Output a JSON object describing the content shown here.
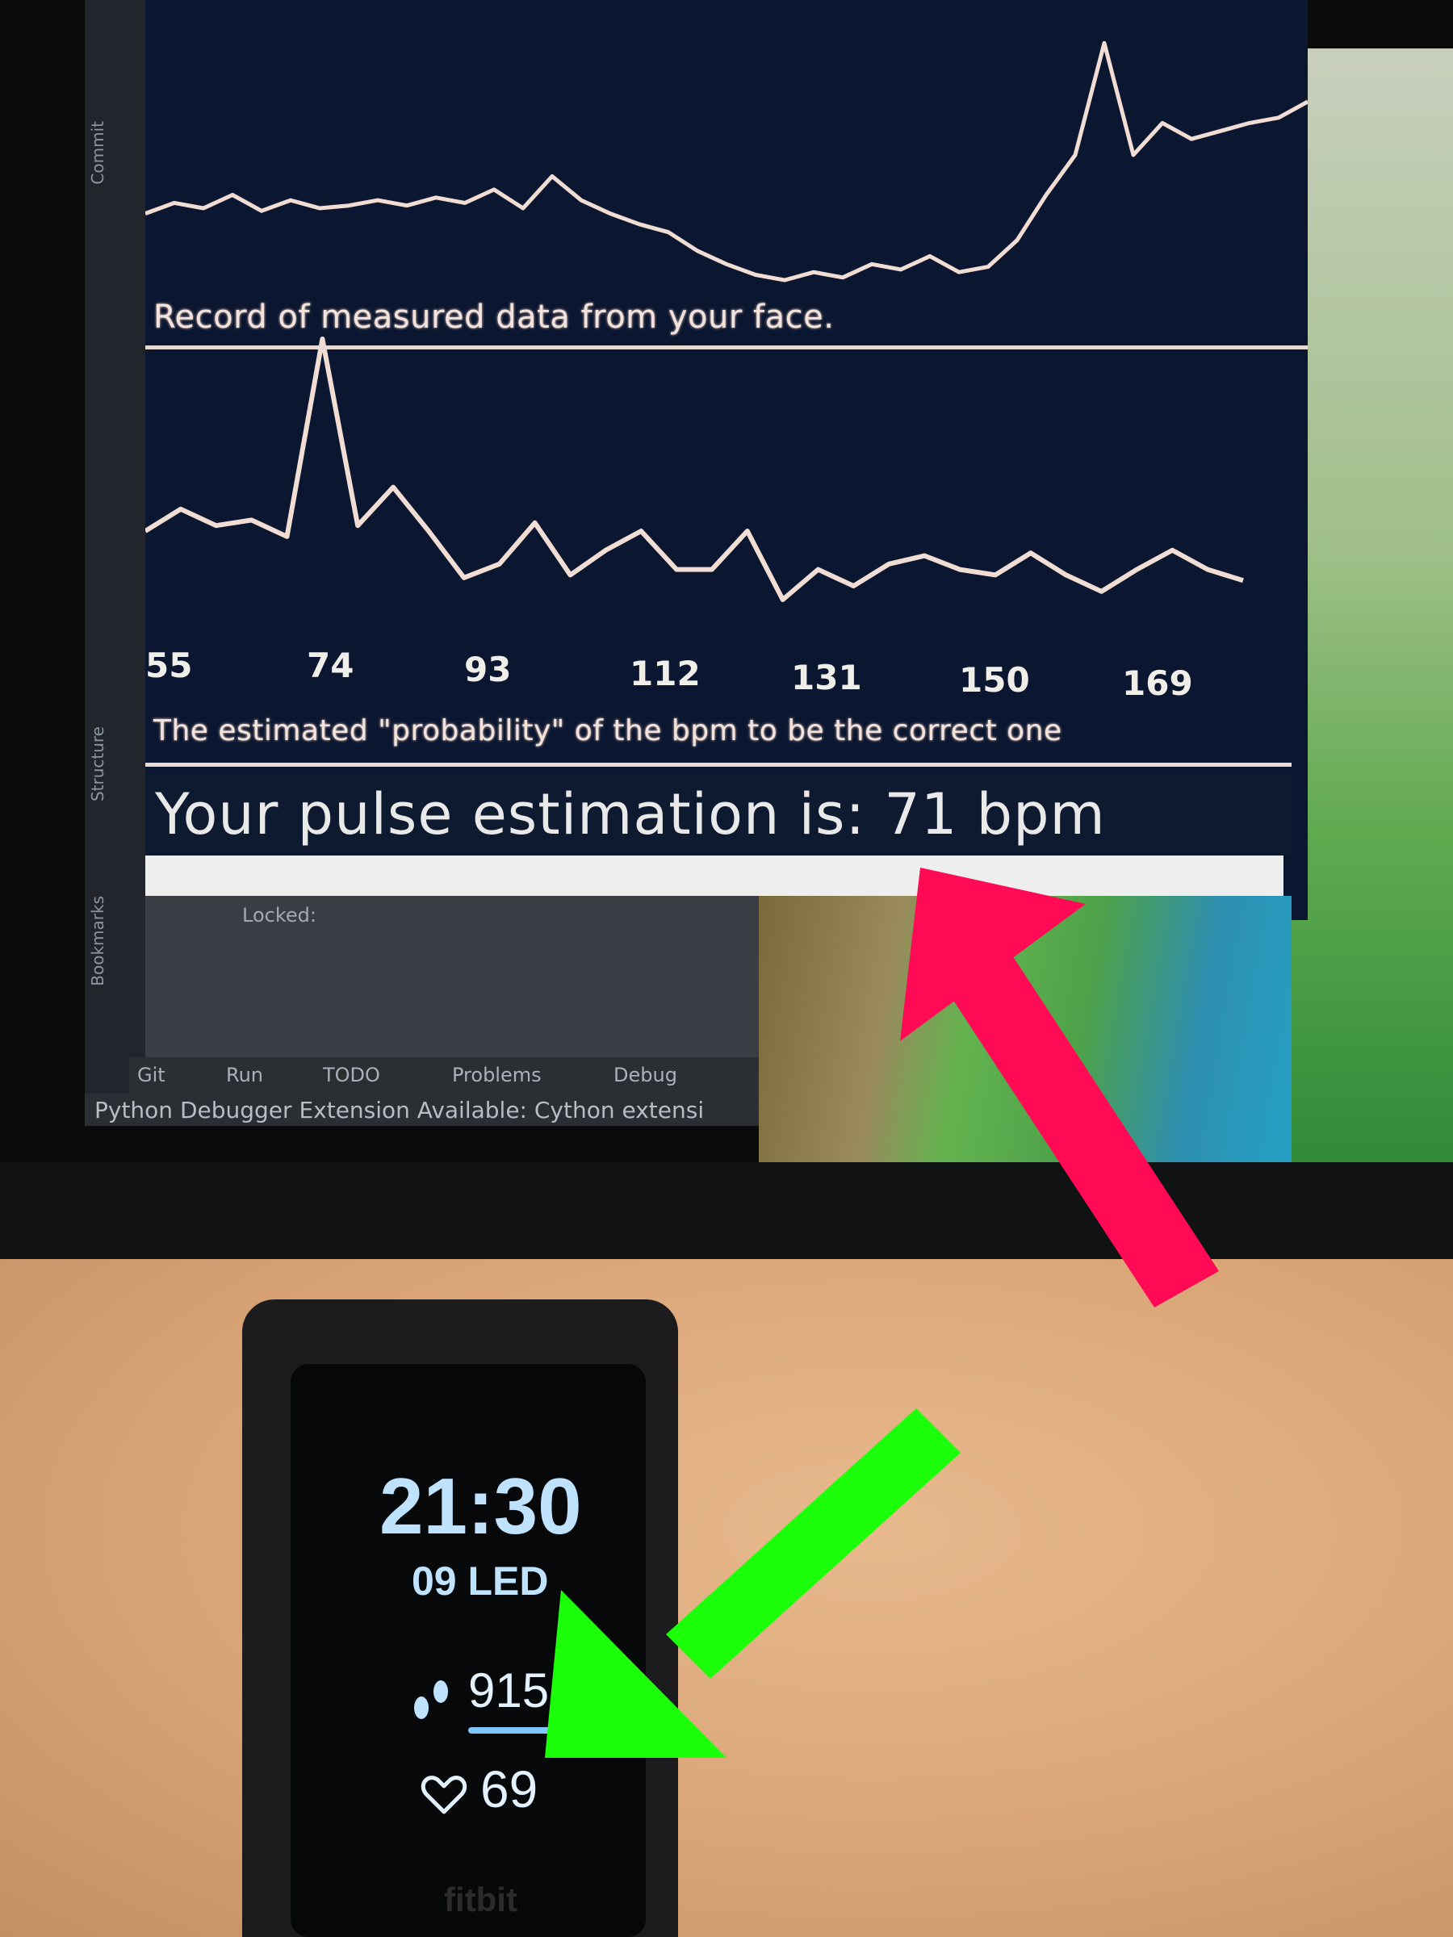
{
  "ide": {
    "sidebar_tabs": [
      "Commit",
      "Structure",
      "Bookmarks"
    ],
    "debug_label": "Locked:",
    "tool_tabs": [
      "Git",
      "Run",
      "TODO",
      "Problems",
      "Debug"
    ],
    "status_text": "Python Debugger Extension Available: Cython extensi"
  },
  "pulse_app": {
    "record_caption": "Record of measured data from your face.",
    "probability_caption": "The estimated \"probability\" of the bpm to be the correct one",
    "bpm_ticks": [
      "55",
      "74",
      "93",
      "112",
      "131",
      "150",
      "169"
    ],
    "result_text": "Your pulse estimation is: 71 bpm",
    "record_series": [
      62,
      58,
      60,
      55,
      61,
      57,
      60,
      59,
      57,
      59,
      56,
      58,
      53,
      60,
      48,
      57,
      62,
      66,
      69,
      76,
      81,
      85,
      87,
      84,
      86,
      81,
      83,
      78,
      84,
      82,
      72,
      55,
      40,
      -2,
      40,
      28,
      34,
      31,
      28,
      26,
      20
    ],
    "probability_series": [
      30,
      38,
      32,
      34,
      28,
      100,
      32,
      46,
      30,
      13,
      18,
      33,
      14,
      23,
      30,
      16,
      16,
      30,
      5,
      16,
      10,
      18,
      21,
      16,
      14,
      22,
      14,
      8,
      16,
      23,
      16,
      12
    ]
  },
  "fitbit": {
    "time": "21:30",
    "date": "09 LED",
    "steps": "915",
    "heart_rate": "69",
    "brand": "fitbit"
  },
  "colors": {
    "plot_background": "#0b1730",
    "plot_line": "#f2ddd4",
    "pink_arrow": "#ff0a55",
    "green_arrow": "#1cff0a",
    "watch_text": "#bfe2ff"
  }
}
